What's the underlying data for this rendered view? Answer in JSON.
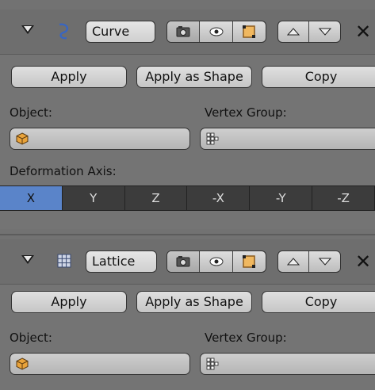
{
  "modifiers": [
    {
      "name": "Curve",
      "type_icon": "curve-icon",
      "apply_label": "Apply",
      "apply_shape_label": "Apply as Shape",
      "copy_label": "Copy",
      "object_label": "Object:",
      "vgroup_label": "Vertex Group:",
      "deform_label": "Deformation Axis:",
      "axes": [
        "X",
        "Y",
        "Z",
        "-X",
        "-Y",
        "-Z"
      ],
      "active_axis": "X"
    },
    {
      "name": "Lattice",
      "type_icon": "lattice-icon",
      "apply_label": "Apply",
      "apply_shape_label": "Apply as Shape",
      "copy_label": "Copy",
      "object_label": "Object:",
      "vgroup_label": "Vertex Group:"
    }
  ],
  "close_glyph": "✕",
  "colors": {
    "active_axis": "#5a84c9",
    "axis_bg": "#3c3c3c",
    "panel_bg": "#747474"
  }
}
